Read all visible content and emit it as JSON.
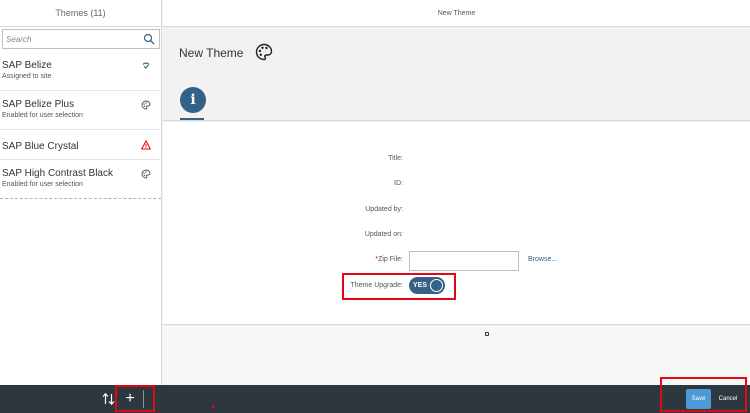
{
  "master": {
    "title": "Themes (11)",
    "search": {
      "placeholder": "Search"
    },
    "items": [
      {
        "title": "SAP Belize",
        "subtitle": "Assigned to site",
        "status_icon": "check-circle-icon",
        "status_color": "#2b7c2b"
      },
      {
        "title": "SAP Belize Plus",
        "subtitle": "Enabled for user selection",
        "status_icon": "palette-small-icon",
        "status_color": "#555555"
      },
      {
        "title": "SAP Blue Crystal",
        "subtitle": "",
        "status_icon": "warning-icon",
        "status_color": "#e60000"
      },
      {
        "title": "SAP High Contrast Black",
        "subtitle": "Enabled for user selection",
        "status_icon": "palette-small-icon",
        "status_color": "#555555"
      }
    ]
  },
  "detail": {
    "header_title": "New Theme",
    "page_title": "New Theme",
    "info_tab_glyph": "i",
    "form": {
      "title_label": "Title:",
      "id_label": "ID:",
      "updated_by_label": "Updated by:",
      "updated_on_label": "Updated on:",
      "zip_required_mark": "*",
      "zip_label": "Zip File:",
      "zip_value": "",
      "browse_label": "Browse...",
      "upgrade_label": "Theme Upgrade:",
      "upgrade_toggle_text": "YES"
    }
  },
  "footer": {
    "add_glyph": "+",
    "save_label": "Save",
    "cancel_label": "Cancel"
  },
  "colors": {
    "accent": "#346187",
    "footer_bg": "#2d3740",
    "save_button": "#4c9bd6",
    "highlight": "#e30613"
  }
}
